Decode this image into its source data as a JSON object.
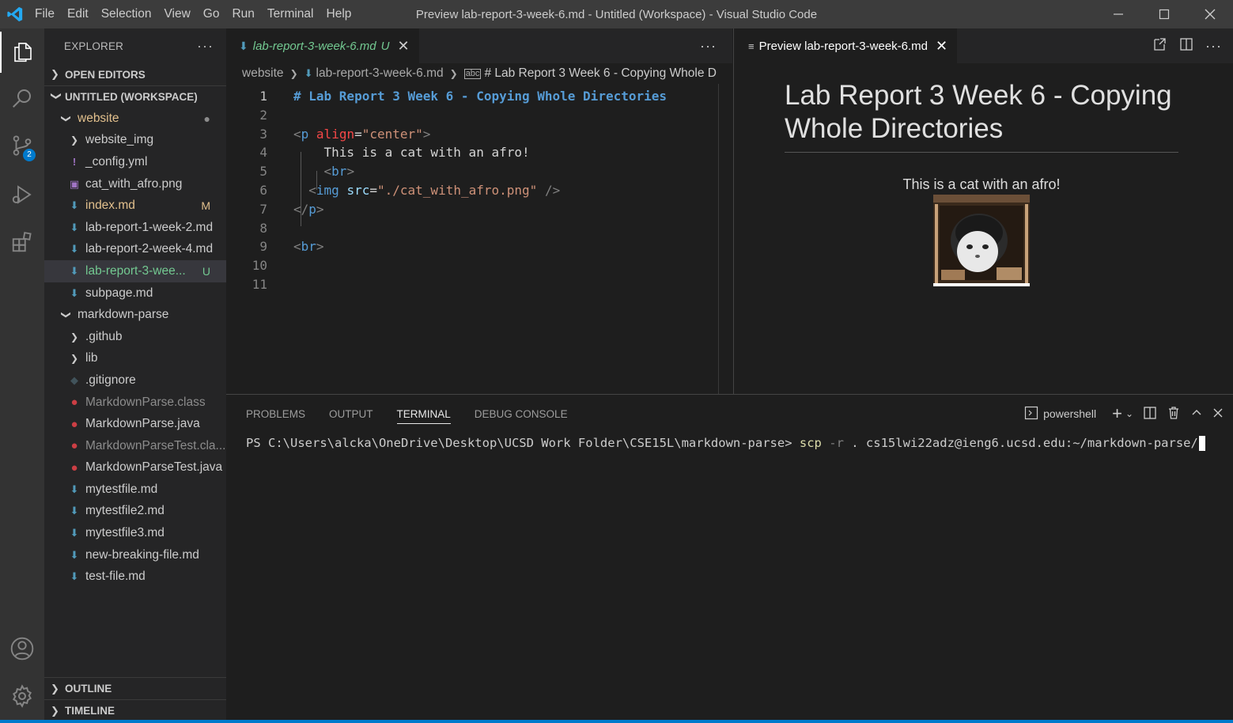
{
  "titlebar": {
    "menu": [
      "File",
      "Edit",
      "Selection",
      "View",
      "Go",
      "Run",
      "Terminal",
      "Help"
    ],
    "title": "Preview lab-report-3-week-6.md - Untitled (Workspace) - Visual Studio Code"
  },
  "activity": {
    "icons": [
      "explorer-icon",
      "search-icon",
      "source-control-icon",
      "run-debug-icon",
      "extensions-icon",
      "account-icon",
      "manage-gear-icon"
    ],
    "scm_badge": "2"
  },
  "sidebar": {
    "title": "EXPLORER",
    "open_editors": "OPEN EDITORS",
    "workspace": "UNTITLED (WORKSPACE)",
    "outline": "OUTLINE",
    "timeline": "TIMELINE",
    "tree": [
      {
        "label": "website",
        "type": "folder-open",
        "depth": 1,
        "color": "#e2c08d",
        "status": "●"
      },
      {
        "label": "website_img",
        "type": "folder",
        "depth": 2,
        "color": "#cccccc",
        "status": ""
      },
      {
        "label": "_config.yml",
        "type": "yml",
        "depth": 2,
        "color": "#cccccc",
        "status": ""
      },
      {
        "label": "cat_with_afro.png",
        "type": "image",
        "depth": 2,
        "color": "#cccccc",
        "status": ""
      },
      {
        "label": "index.md",
        "type": "md",
        "depth": 2,
        "color": "#e2c08d",
        "status": "M"
      },
      {
        "label": "lab-report-1-week-2.md",
        "type": "md",
        "depth": 2,
        "color": "#cccccc",
        "status": ""
      },
      {
        "label": "lab-report-2-week-4.md",
        "type": "md",
        "depth": 2,
        "color": "#cccccc",
        "status": ""
      },
      {
        "label": "lab-report-3-wee...",
        "type": "md",
        "depth": 2,
        "color": "#73c991",
        "status": "U",
        "selected": true
      },
      {
        "label": "subpage.md",
        "type": "md",
        "depth": 2,
        "color": "#cccccc",
        "status": ""
      },
      {
        "label": "markdown-parse",
        "type": "folder-open",
        "depth": 1,
        "color": "#cccccc",
        "status": ""
      },
      {
        "label": ".github",
        "type": "folder",
        "depth": 2,
        "color": "#cccccc",
        "status": ""
      },
      {
        "label": "lib",
        "type": "folder",
        "depth": 2,
        "color": "#cccccc",
        "status": ""
      },
      {
        "label": ".gitignore",
        "type": "gitignore",
        "depth": 2,
        "color": "#cccccc",
        "status": ""
      },
      {
        "label": "MarkdownParse.class",
        "type": "java",
        "depth": 2,
        "color": "#8c8c8c",
        "status": ""
      },
      {
        "label": "MarkdownParse.java",
        "type": "java",
        "depth": 2,
        "color": "#cccccc",
        "status": ""
      },
      {
        "label": "MarkdownParseTest.cla...",
        "type": "java",
        "depth": 2,
        "color": "#8c8c8c",
        "status": ""
      },
      {
        "label": "MarkdownParseTest.java",
        "type": "java",
        "depth": 2,
        "color": "#cccccc",
        "status": ""
      },
      {
        "label": "mytestfile.md",
        "type": "md",
        "depth": 2,
        "color": "#cccccc",
        "status": ""
      },
      {
        "label": "mytestfile2.md",
        "type": "md",
        "depth": 2,
        "color": "#cccccc",
        "status": ""
      },
      {
        "label": "mytestfile3.md",
        "type": "md",
        "depth": 2,
        "color": "#cccccc",
        "status": ""
      },
      {
        "label": "new-breaking-file.md",
        "type": "md",
        "depth": 2,
        "color": "#cccccc",
        "status": ""
      },
      {
        "label": "test-file.md",
        "type": "md",
        "depth": 2,
        "color": "#cccccc",
        "status": ""
      }
    ]
  },
  "editor": {
    "tab_label": "lab-report-3-week-6.md",
    "tab_status": "U",
    "breadcrumb": [
      "website",
      "lab-report-3-week-6.md",
      "# Lab Report 3 Week 6 - Copying Whole D"
    ],
    "line_numbers": [
      "1",
      "2",
      "3",
      "4",
      "5",
      "6",
      "7",
      "8",
      "9",
      "10",
      "11"
    ],
    "lines": [
      "# Lab Report 3 Week 6 - Copying Whole Directories",
      "",
      "<p align=\"center\">",
      "    This is a cat with an afro!",
      "    <br>",
      "  <img src=\"./cat_with_afro.png\" />",
      "</p>",
      "",
      "<br>",
      "",
      ""
    ]
  },
  "preview": {
    "tab_label": "Preview lab-report-3-week-6.md",
    "heading": "Lab Report 3 Week 6 - Copying Whole Directories",
    "paragraph": "This is a cat with an afro!",
    "image_alt": "cat-with-afro-image"
  },
  "panel": {
    "tabs": [
      "PROBLEMS",
      "OUTPUT",
      "TERMINAL",
      "DEBUG CONSOLE"
    ],
    "active_tab": "TERMINAL",
    "shell": "powershell",
    "prompt": "PS C:\\Users\\alcka\\OneDrive\\Desktop\\UCSD Work Folder\\CSE15L\\markdown-parse> ",
    "cmd": "scp",
    "flag": "-r",
    "args": ". cs15lwi22adz@ieng6.ucsd.edu:~/markdown-parse/"
  },
  "colors": {
    "accent": "#007acc",
    "modified": "#e2c08d",
    "untracked": "#73c991",
    "java": "#cc3e44",
    "md_icon": "#519aba"
  }
}
